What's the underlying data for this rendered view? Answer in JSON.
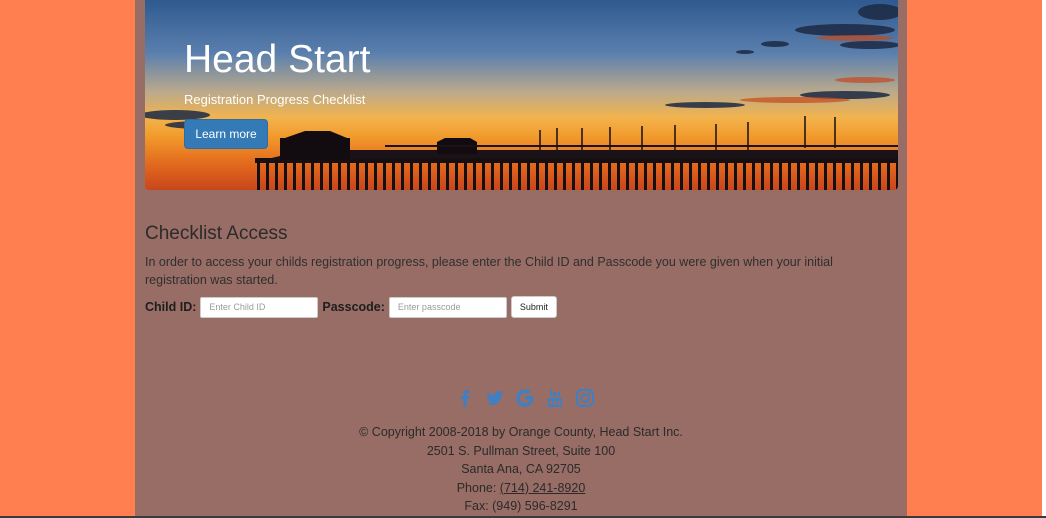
{
  "hero": {
    "title": "Head Start",
    "subtitle": "Registration Progress Checklist",
    "button_label": "Learn more"
  },
  "checklist": {
    "title": "Checklist Access",
    "instructions": "In order to access your childs registration progress, please enter the Child ID and Passcode you were given when your initial registration was started.",
    "child_id_label": "Child ID:",
    "child_id_placeholder": "Enter Child ID",
    "child_id_value": "",
    "passcode_label": "Passcode:",
    "passcode_placeholder": "Enter passcode",
    "passcode_value": "",
    "submit_label": "Submit"
  },
  "social": [
    "facebook-icon",
    "twitter-icon",
    "google-icon",
    "youtube-icon",
    "instagram-icon"
  ],
  "footer": {
    "copyright": "© Copyright 2008-2018 by Orange County, Head Start Inc.",
    "address1": "2501 S. Pullman Street, Suite 100",
    "address2": "Santa Ana, CA 92705",
    "phone_label": "Phone: ",
    "phone": "(714) 241-8920",
    "fax": "Fax: (949) 596-8291"
  },
  "colors": {
    "background": "#ff7f50",
    "content_bg": "#976d65",
    "accent": "#337ab7",
    "icon": "#3f7fc4"
  }
}
